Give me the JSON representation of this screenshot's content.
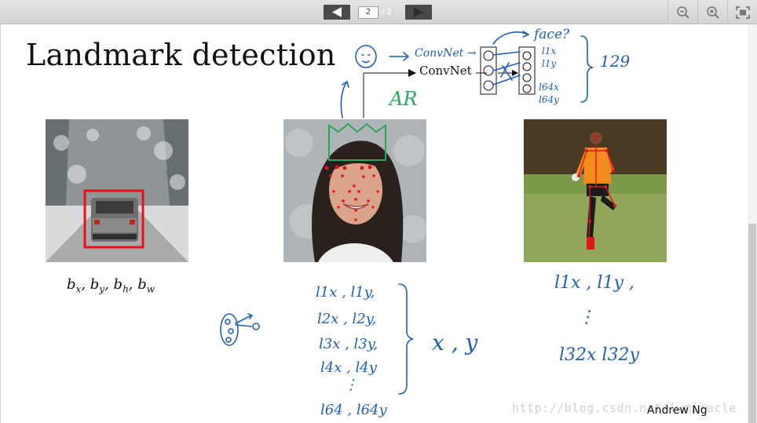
{
  "viewer": {
    "current_page": "2",
    "page_separator": "/ 2",
    "prev_icon": "triangle-left-icon",
    "next_icon": "triangle-right-icon",
    "tools": [
      "zoom-out-icon",
      "zoom-in-icon",
      "fullscreen-icon"
    ]
  },
  "slide": {
    "title": "Landmark detection",
    "bbox_symbols": [
      "b",
      "x",
      "b",
      "y",
      "b",
      "h",
      "b",
      "w"
    ],
    "convnet_label": "ConvNet",
    "author": "Andrew Ng",
    "watermark": "http://blog.csdn.net/lwmiracle"
  },
  "annotations": {
    "top": {
      "convnet_scrawl": "ConvNet →",
      "face_q": "face?",
      "outputs": [
        "l1x",
        "l1y",
        "l64x",
        "l64y"
      ],
      "count": "129",
      "ar": "AR"
    },
    "face_list": [
      "l1x , l1y,",
      "l2x , l2y,",
      "l3x , l3y,",
      "l4x , l4y",
      "⋮",
      "l64 , l64y"
    ],
    "face_xy": "x , y",
    "pose_list": [
      "l1x , l1y ,",
      "⋮",
      "l32x l32y"
    ]
  },
  "colors": {
    "toolbar": "#d9d9d9",
    "ink_blue": "#1f5fb8",
    "ink_green": "#2aa65a",
    "box_red": "#e8101a"
  }
}
